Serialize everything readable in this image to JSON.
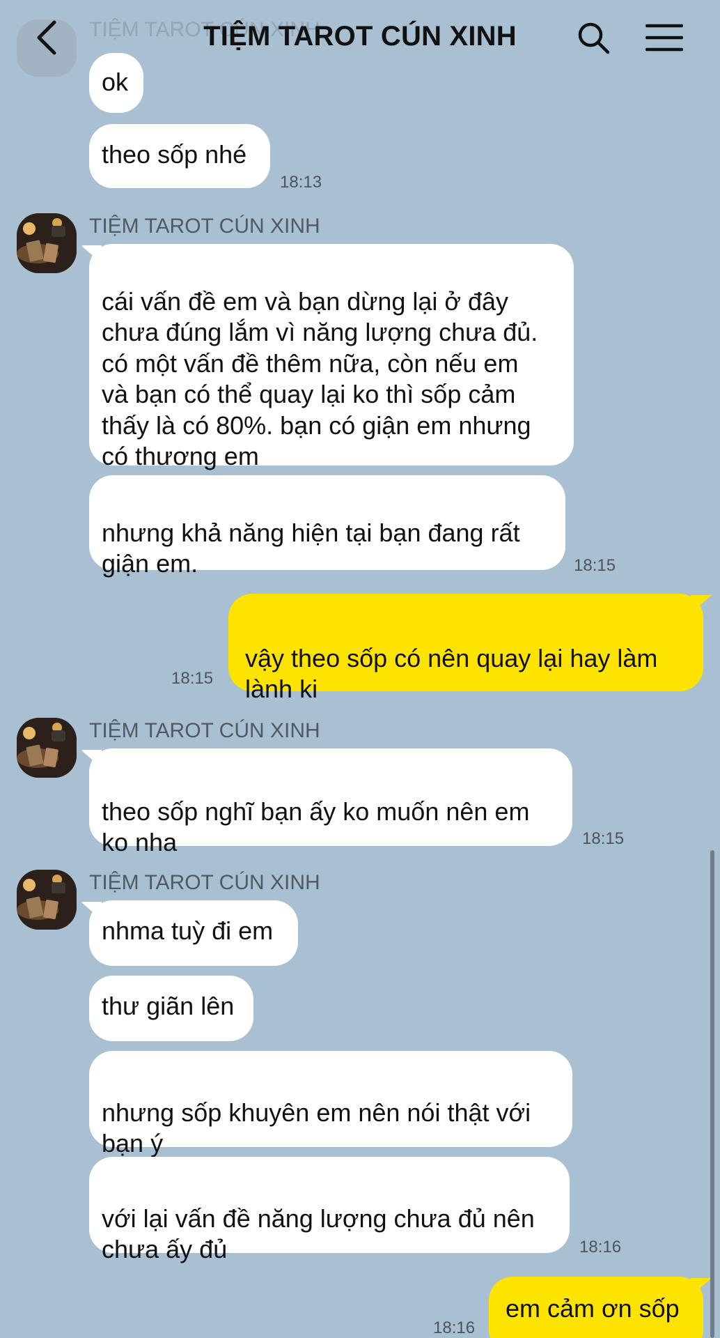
{
  "header": {
    "title": "TIỆM TAROT CÚN XINH",
    "back_icon": "chevron-left-icon",
    "search_icon": "search-icon",
    "menu_icon": "hamburger-menu-icon"
  },
  "ghost_sender": "TIỆM TAROT CÚN XINH",
  "colors": {
    "background": "#a9bfd2",
    "incoming_bubble": "#ffffff",
    "outgoing_bubble": "#fde400",
    "time_text": "#4a5560"
  },
  "messages": {
    "m1": {
      "text": "ok"
    },
    "m2": {
      "text": "theo sốp nhé",
      "time": "18:13"
    },
    "g1": {
      "sender": "TIỆM TAROT CÚN XINH"
    },
    "m3": {
      "text": "cái vấn đề em và bạn dừng lại ở đây\nchưa đúng lắm vì năng lượng chưa đủ.\ncó một vấn đề thêm nữa, còn nếu em\nvà bạn có thể quay lại ko thì sốp cảm\nthấy là có 80%. bạn có giận em nhưng\ncó thương em"
    },
    "m4": {
      "text": "nhưng khả năng hiện tại bạn đang rất\ngiận em.",
      "time": "18:15"
    },
    "m5": {
      "text": "vậy theo sốp có nên quay lại hay làm\nlành ki",
      "time": "18:15"
    },
    "g2": {
      "sender": "TIỆM TAROT CÚN XINH"
    },
    "m6": {
      "text": "theo sốp nghĩ bạn ấy ko muốn nên em\nko nha",
      "time": "18:15"
    },
    "g3": {
      "sender": "TIỆM TAROT CÚN XINH"
    },
    "m7": {
      "text": "nhma tuỳ đi em"
    },
    "m8": {
      "text": "thư giãn lên"
    },
    "m9": {
      "text": "nhưng sốp khuyên em nên nói thật với\nbạn ý"
    },
    "m10": {
      "text": "với lại vấn đề năng lượng chưa đủ nên\nchưa ấy đủ",
      "time": "18:16"
    },
    "m11": {
      "text": "em cảm ơn sốp",
      "time": "18:16"
    }
  }
}
